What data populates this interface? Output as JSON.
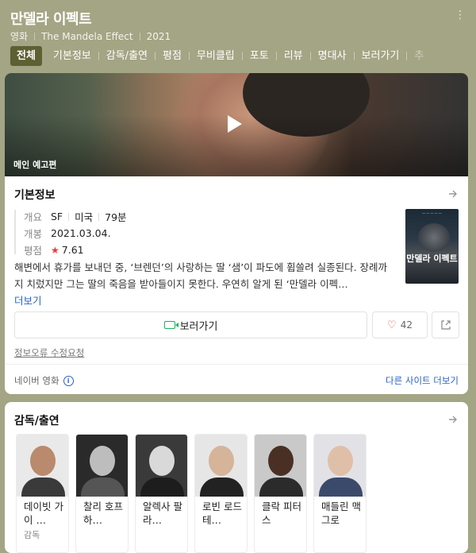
{
  "header": {
    "title": "만델라 이펙트",
    "meta": [
      "영화",
      "The Mandela Effect",
      "2021"
    ],
    "tabs": [
      "전체",
      "기본정보",
      "감독/출연",
      "평점",
      "무비클립",
      "포토",
      "리뷰",
      "명대사",
      "보러가기",
      "추"
    ]
  },
  "video": {
    "label": "메인 예고편"
  },
  "basic_info": {
    "section_title": "기본정보",
    "overview_label": "개요",
    "genre": "SF",
    "country": "미국",
    "runtime": "79분",
    "release_label": "개봉",
    "release_date": "2021.03.04.",
    "rating_label": "평점",
    "rating": "7.61",
    "synopsis": "해변에서 휴가를 보내던 중, ‘브렌던’의 사랑하는 딸 ‘샘’이 파도에 휩쓸려 실종된다. 장례까지 치렀지만 그는 딸의 죽음을 받아들이지 못한다. 우연히 알게 된 ‘만델라 이펙…",
    "more_label": "더보기",
    "poster_title": "만델라 이펙트",
    "watch_label": "보러가기",
    "like_count": "42",
    "report_label": "정보오류 수정요청",
    "source_label": "네이버 영화",
    "other_sites_label": "다른 사이트 더보기"
  },
  "cast": {
    "section_title": "감독/출연",
    "people": [
      {
        "name": "데이빗 가이 …",
        "role": "감독"
      },
      {
        "name": "찰리 호프하…",
        "role": ""
      },
      {
        "name": "알렉사 팔라…",
        "role": ""
      },
      {
        "name": "로빈 로드 테…",
        "role": ""
      },
      {
        "name": "클락 피터스",
        "role": ""
      },
      {
        "name": "매들린 맥그로",
        "role": ""
      }
    ]
  },
  "colors": {
    "header_bg": "#a3a584",
    "active_tab": "#5c6032",
    "link": "#2a5fc9",
    "accent_green": "#19b35d"
  }
}
